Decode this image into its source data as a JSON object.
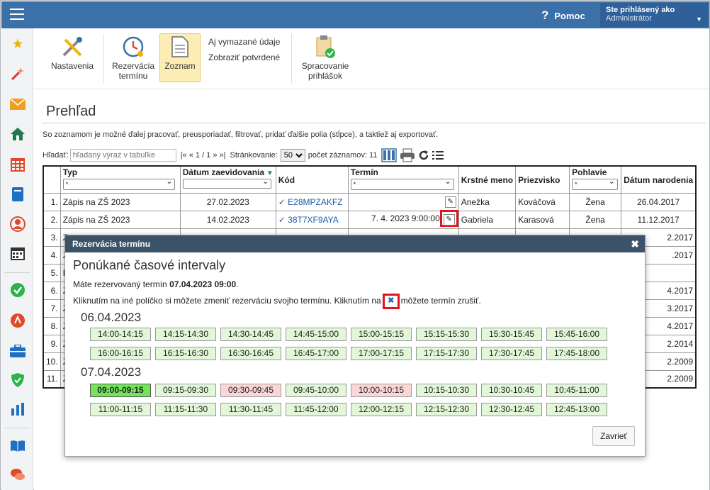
{
  "header": {
    "help": "Pomoc",
    "user_line1": "Ste prihlásený ako",
    "user_line2": "Administrátor"
  },
  "toolbar": {
    "settings": "Nastavenia",
    "reservation_l1": "Rezervácia",
    "reservation_l2": "termínu",
    "list": "Zoznam",
    "show_deleted": "Aj vymazané údaje",
    "show_confirmed": "Zobraziť potvrdené",
    "process_l1": "Spracovanie",
    "process_l2": "prihlášok"
  },
  "page": {
    "title": "Prehľad",
    "description": "So zoznamom je možné ďalej pracovať, preusporiadať, filtrovať, pridať ďalšie polia (stĺpce), a taktiež aj exportovať."
  },
  "filters": {
    "search_label": "Hľadať:",
    "search_placeholder": "hľadaný výraz v tabuľke",
    "pager": "|« « 1 / 1 » »|",
    "paging_label": "Stránkovanie:",
    "paging_value": "50",
    "count_label": "počet záznamov: 11"
  },
  "table": {
    "headers": {
      "typ": "Typ",
      "datum": "Dátum zaevidovania",
      "kod": "Kód",
      "termin": "Termín",
      "meno": "Krstné meno",
      "priezvisko": "Priezvisko",
      "pohlavie": "Pohlavie",
      "narodenie": "Dátum narodenia"
    },
    "filter_all": "*",
    "rows": [
      {
        "n": "1.",
        "typ": "Zápis na ZŠ 2023",
        "datum": "27.02.2023",
        "kod": "✓ E28MPZAKFZ",
        "termin": "",
        "meno": "Anežka",
        "priezvisko": "Kováčová",
        "pohlavie": "Žena",
        "narodenie": "26.04.2017"
      },
      {
        "n": "2.",
        "typ": "Zápis na ZŠ 2023",
        "datum": "14.02.2023",
        "kod": "✓ 38T7XF9AYA",
        "termin": "7. 4. 2023 9:00:00",
        "meno": "Gabriela",
        "priezvisko": "Karasová",
        "pohlavie": "Žena",
        "narodenie": "11.12.2017"
      },
      {
        "n": "3.",
        "typ": "Z",
        "narodenie": "2.2017"
      },
      {
        "n": "4.",
        "typ": "Z",
        "narodenie": ".2017"
      },
      {
        "n": "5.",
        "typ": "P",
        "narodenie": ""
      },
      {
        "n": "6.",
        "typ": "Z",
        "narodenie": "4.2017"
      },
      {
        "n": "7.",
        "typ": "Z",
        "narodenie": "3.2017"
      },
      {
        "n": "8.",
        "typ": "Z",
        "narodenie": "4.2017"
      },
      {
        "n": "9.",
        "typ": "Z",
        "narodenie": "2.2014"
      },
      {
        "n": "10.",
        "typ": "Z",
        "narodenie": "2.2009"
      },
      {
        "n": "11.",
        "typ": "Z",
        "narodenie": "2.2009"
      }
    ]
  },
  "dialog": {
    "header": "Rezervácia termínu",
    "title": "Ponúkané časové intervaly",
    "reserved_prefix": "Máte rezervovaný termín ",
    "reserved_value": "07.04.2023 09:00",
    "reserved_suffix": ".",
    "hint_before": "Kliknutím na iné políčko si môžete zmeniť rezerváciu svojho termínu. Kliknutím na",
    "hint_after": "môžete termín zrušiť.",
    "days": [
      {
        "date": "06.04.2023",
        "slots": [
          {
            "t": "14:00-14:15",
            "s": "free"
          },
          {
            "t": "14:15-14:30",
            "s": "free"
          },
          {
            "t": "14:30-14:45",
            "s": "free"
          },
          {
            "t": "14:45-15:00",
            "s": "free"
          },
          {
            "t": "15:00-15:15",
            "s": "free"
          },
          {
            "t": "15:15-15:30",
            "s": "free"
          },
          {
            "t": "15:30-15:45",
            "s": "free"
          },
          {
            "t": "15:45-16:00",
            "s": "free"
          },
          {
            "t": "16:00-16:15",
            "s": "free"
          },
          {
            "t": "16:15-16:30",
            "s": "free"
          },
          {
            "t": "16:30-16:45",
            "s": "free"
          },
          {
            "t": "16:45-17:00",
            "s": "free"
          },
          {
            "t": "17:00-17:15",
            "s": "free"
          },
          {
            "t": "17:15-17:30",
            "s": "free"
          },
          {
            "t": "17:30-17:45",
            "s": "free"
          },
          {
            "t": "17:45-18:00",
            "s": "free"
          }
        ]
      },
      {
        "date": "07.04.2023",
        "slots": [
          {
            "t": "09:00-09:15",
            "s": "selected"
          },
          {
            "t": "09:15-09:30",
            "s": "free"
          },
          {
            "t": "09:30-09:45",
            "s": "busy"
          },
          {
            "t": "09:45-10:00",
            "s": "free"
          },
          {
            "t": "10:00-10:15",
            "s": "busy"
          },
          {
            "t": "10:15-10:30",
            "s": "free"
          },
          {
            "t": "10:30-10:45",
            "s": "free"
          },
          {
            "t": "10:45-11:00",
            "s": "free"
          },
          {
            "t": "11:00-11:15",
            "s": "free"
          },
          {
            "t": "11:15-11:30",
            "s": "free"
          },
          {
            "t": "11:30-11:45",
            "s": "free"
          },
          {
            "t": "11:45-12:00",
            "s": "free"
          },
          {
            "t": "12:00-12:15",
            "s": "free"
          },
          {
            "t": "12:15-12:30",
            "s": "free"
          },
          {
            "t": "12:30-12:45",
            "s": "free"
          },
          {
            "t": "12:45-13:00",
            "s": "free"
          }
        ]
      }
    ],
    "close_button": "Zavrieť"
  },
  "sidebar_icons": [
    "star-icon",
    "magic-wand-icon",
    "mail-icon",
    "home-icon",
    "calendar-grid-icon",
    "book-icon",
    "user-icon",
    "calendar-icon",
    "check-circle-icon",
    "alert-circle-icon",
    "briefcase-icon",
    "shield-icon",
    "bar-chart-icon",
    "open-book-icon",
    "chat-icon"
  ]
}
